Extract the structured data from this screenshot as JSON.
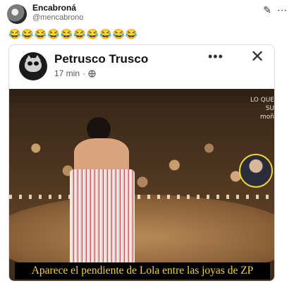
{
  "tweet": {
    "display_name": "Encabroná",
    "handle": "@mencabrono",
    "emojis": "😂😂😂😂😂😂😂😂😂😂"
  },
  "header_icons": [
    "edit-icon",
    "more-icon"
  ],
  "embedded_post": {
    "author": "Petrusco Trusco",
    "time": "17 min",
    "separator": "·",
    "privacy_icon": "globe-icon",
    "more_label": "•••",
    "close_label": "✕",
    "image": {
      "caption": "Aparece el pendiente de Lola entre las joyas de ZP",
      "corner_text_lines": [
        "LO QUE",
        "SU",
        "moñ"
      ]
    }
  },
  "colors": {
    "caption_text": "#f2d23a",
    "caption_bg": "#000000",
    "highlight_circle": "#f2d23a"
  }
}
